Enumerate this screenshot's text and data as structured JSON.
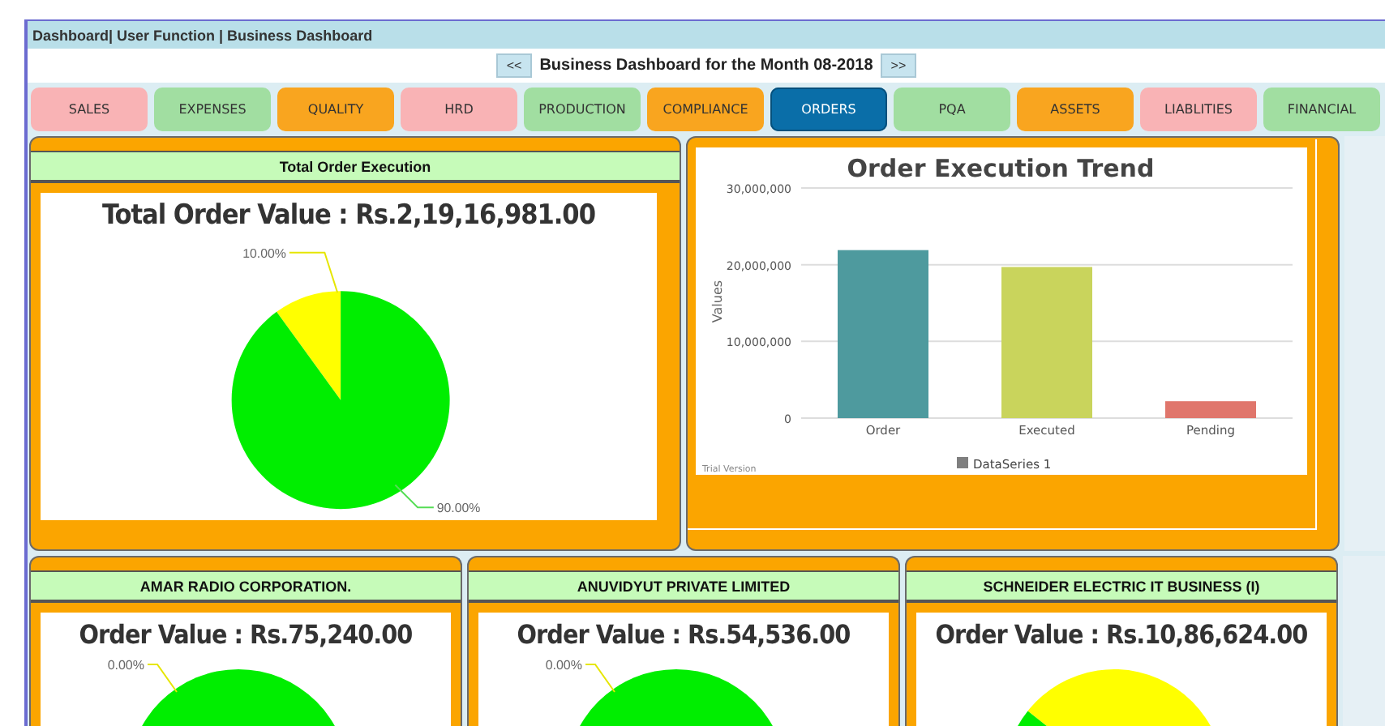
{
  "breadcrumb": "Dashboard| User Function | Business Dashboard",
  "period_nav": {
    "prev": "<<",
    "title": "Business Dashboard for the Month 08-2018",
    "next": ">>"
  },
  "tabs": [
    {
      "label": "SALES",
      "color": "#f9b3b5",
      "selected": false
    },
    {
      "label": "EXPENSES",
      "color": "#a1dea1",
      "selected": false
    },
    {
      "label": "QUALITY",
      "color": "#f9a51f",
      "selected": false
    },
    {
      "label": "HRD",
      "color": "#f9b3b5",
      "selected": false
    },
    {
      "label": "PRODUCTION",
      "color": "#a1dea1",
      "selected": false
    },
    {
      "label": "COMPLIANCE",
      "color": "#f9a51f",
      "selected": false
    },
    {
      "label": "ORDERS",
      "color": "#0a6ea8",
      "selected": true
    },
    {
      "label": "PQA",
      "color": "#a1dea1",
      "selected": false
    },
    {
      "label": "ASSETS",
      "color": "#f9a51f",
      "selected": false
    },
    {
      "label": "LIABLITIES",
      "color": "#f9b3b5",
      "selected": false
    },
    {
      "label": "FINANCIAL",
      "color": "#a1dea1",
      "selected": false
    }
  ],
  "total_panel": {
    "title": "Total Order Execution",
    "value_title": "Total Order Value : Rs.2,19,16,981.00",
    "chart_data": {
      "type": "pie",
      "values": [
        10,
        90
      ],
      "value_labels": [
        "10.00%",
        "90.00%"
      ]
    }
  },
  "trend_panel": {
    "chart_data": {
      "type": "bar",
      "title": "Order Execution Trend",
      "ylabel": "Values",
      "categories": [
        "Order",
        "Executed",
        "Pending"
      ],
      "series": [
        {
          "name": "DataSeries 1",
          "values": [
            21900000,
            19700000,
            2200000
          ]
        }
      ],
      "ylim": [
        0,
        30000000
      ],
      "yticks": [
        {
          "value": 0,
          "label": "0"
        },
        {
          "value": 10000000,
          "label": "10,000,000"
        },
        {
          "value": 20000000,
          "label": "20,000,000"
        },
        {
          "value": 30000000,
          "label": "30,000,000"
        }
      ]
    },
    "watermark_note": "Trial Version"
  },
  "customers": [
    {
      "name": "AMAR RADIO CORPORATION.",
      "value_title": "Order Value  : Rs.75,240.00",
      "kind": "full",
      "pie_label": "0.00%"
    },
    {
      "name": "ANUVIDYUT PRIVATE LIMITED",
      "value_title": "Order Value  : Rs.54,536.00",
      "kind": "full",
      "pie_label": "0.00%"
    },
    {
      "name": "SCHNEIDER ELECTRIC IT BUSINESS (I)",
      "value_title": "Order Value  : Rs.10,86,624.00",
      "kind": "split"
    }
  ]
}
